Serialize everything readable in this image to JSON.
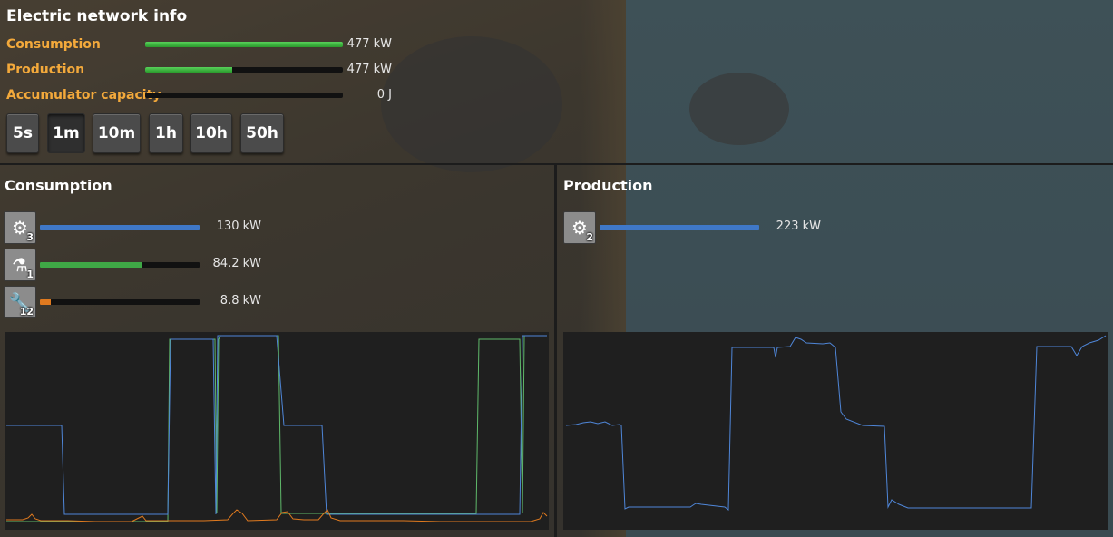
{
  "window": {
    "title": "Electric network info"
  },
  "stats": [
    {
      "key": "consumption",
      "label": "Consumption",
      "value": "477 kW",
      "fill": 1.0
    },
    {
      "key": "production",
      "label": "Production",
      "value": "477 kW",
      "fill": 0.44
    },
    {
      "key": "accumulator",
      "label": "Accumulator capacity",
      "value": "0 J",
      "fill": 0.0
    }
  ],
  "time_buttons": [
    {
      "label": "5s",
      "selected": false
    },
    {
      "label": "1m",
      "selected": true
    },
    {
      "label": "10m",
      "selected": false
    },
    {
      "label": "1h",
      "selected": false
    },
    {
      "label": "10h",
      "selected": false
    },
    {
      "label": "50h",
      "selected": false
    }
  ],
  "consumption": {
    "title": "Consumption",
    "entities": [
      {
        "icon": "assembling-machine-icon",
        "count": "3",
        "value": "130 kW",
        "fill": 1.0,
        "color": "#3f78c8"
      },
      {
        "icon": "lab-icon",
        "count": "1",
        "value": "84.2 kW",
        "fill": 0.64,
        "color": "#3fa846"
      },
      {
        "icon": "inserter-icon",
        "count": "12",
        "value": "8.8 kW",
        "fill": 0.07,
        "color": "#e07a1f"
      }
    ]
  },
  "production": {
    "title": "Production",
    "entities": [
      {
        "icon": "steam-engine-icon",
        "count": "2",
        "value": "223 kW",
        "fill": 1.0,
        "color": "#3f78c8"
      }
    ]
  },
  "colors": {
    "accent_label": "#f3a93b",
    "series_blue": "#4f86d8",
    "series_green": "#5fb86a",
    "series_orange": "#e07a1f",
    "graph_bg": "#1f1f1f"
  }
}
